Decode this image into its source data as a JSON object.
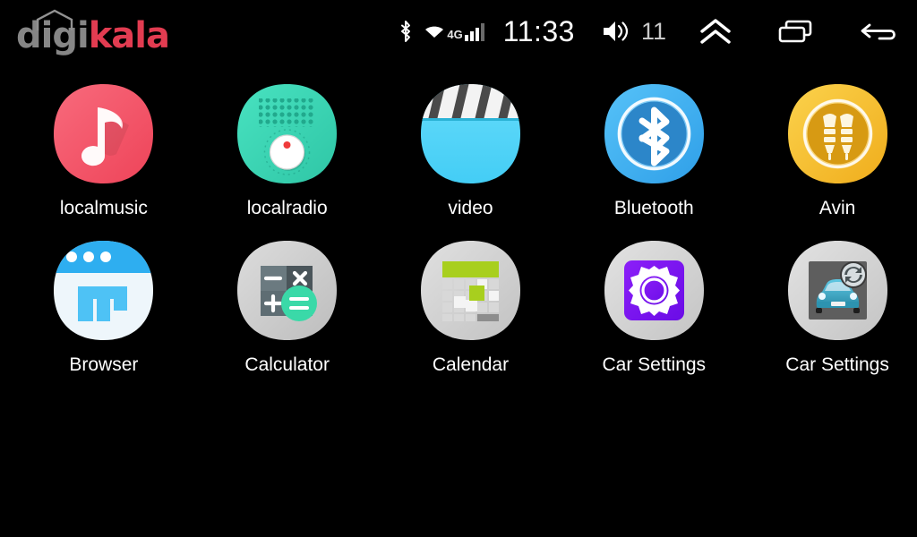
{
  "watermark": {
    "part1": "digi",
    "part2": "kala",
    "icon": "house-roof-icon"
  },
  "status_bar": {
    "bluetooth_icon": "bluetooth-icon",
    "wifi_icon": "wifi-icon",
    "network_type": "4G",
    "signal_icon": "signal-bars-icon",
    "time": "11:33",
    "volume_icon": "speaker-volume-icon",
    "volume_level": "11",
    "home_icon": "double-chevron-up-icon",
    "recents_icon": "recent-apps-icon",
    "back_icon": "back-arrow-icon"
  },
  "colors": {
    "background": "#000000",
    "localmusic": "#f4566b",
    "localradio": "#3cd6b4",
    "video": "#5bd6f8",
    "bluetooth": "#45b6f2",
    "avin": "#f6c632",
    "browser": "#2eaef0",
    "calculator": "#c9c9c9",
    "calendar": "#a8cf1e",
    "car_settings_1": "#7b15f5",
    "car_settings_2": "#3fa7c4",
    "label_text": "#ffffff",
    "watermark_gray": "#8e8e8e",
    "watermark_red": "#ef4056"
  },
  "app_grid": {
    "rows": [
      {
        "apps": [
          {
            "label": "localmusic",
            "icon": "music-note-icon"
          },
          {
            "label": "localradio",
            "icon": "radio-icon"
          },
          {
            "label": "video",
            "icon": "clapperboard-icon"
          },
          {
            "label": "Bluetooth",
            "icon": "bluetooth-icon"
          },
          {
            "label": "Avin",
            "icon": "rca-plugs-icon"
          }
        ]
      },
      {
        "apps": [
          {
            "label": "Browser",
            "icon": "browser-window-icon"
          },
          {
            "label": "Calculator",
            "icon": "calculator-icon"
          },
          {
            "label": "Calendar",
            "icon": "calendar-icon"
          },
          {
            "label": "Car Settings",
            "icon": "gear-icon"
          },
          {
            "label": "Car Settings",
            "icon": "car-sync-icon"
          }
        ]
      }
    ]
  }
}
